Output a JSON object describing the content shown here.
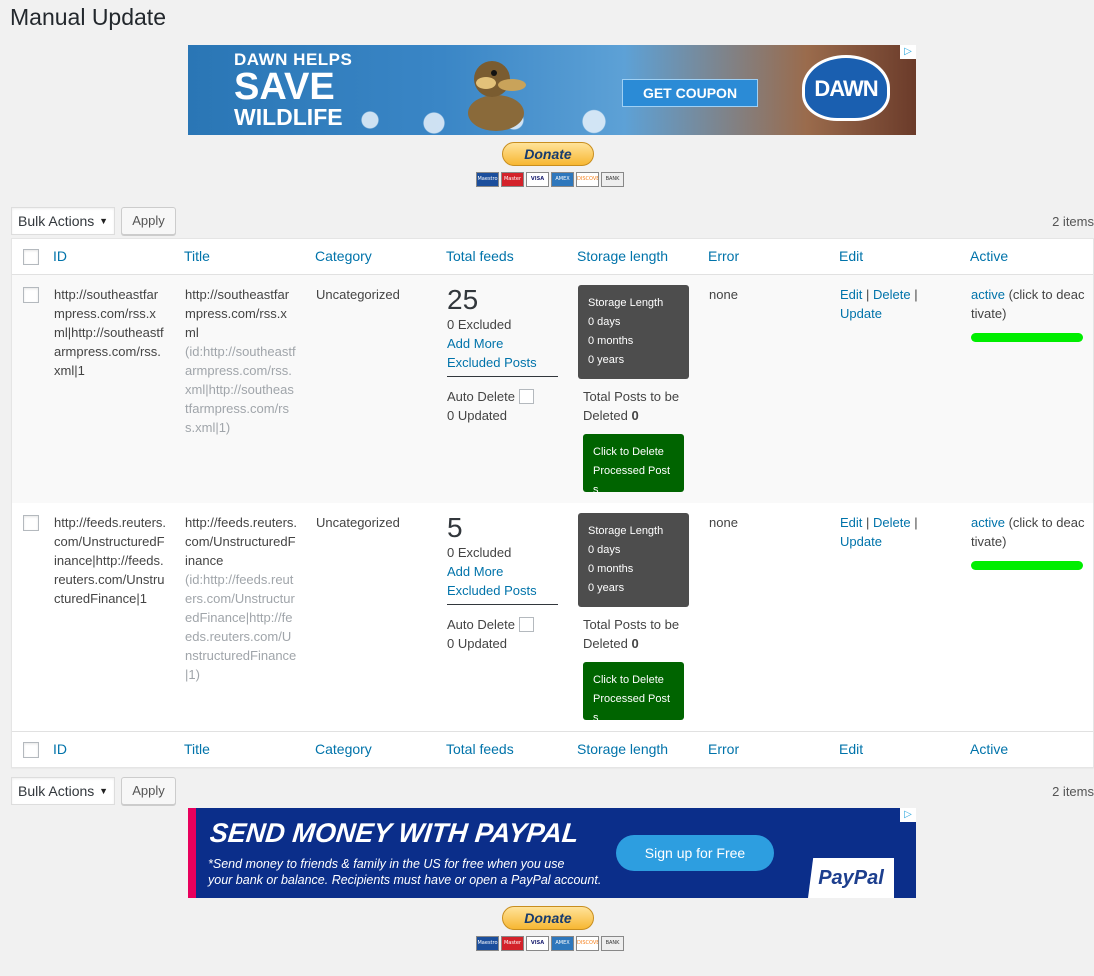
{
  "page": {
    "title": "Manual Update"
  },
  "ad_top": {
    "line1": "DAWN HELPS",
    "line2": "SAVE",
    "line3": "WILDLIFE",
    "button": "GET COUPON",
    "logo": "DAWN",
    "adchoices": "▷"
  },
  "ad_bottom": {
    "title": "SEND MONEY WITH PAYPAL",
    "sub1": "*Send money to friends & family in the US for free when you use",
    "sub2": "your bank or balance.  Recipients must have or open a PayPal account.",
    "button": "Sign up for Free",
    "logo": "PayPal",
    "adchoices": "▷"
  },
  "donate": {
    "label": "Donate",
    "cards": [
      "Maestro",
      "Master",
      "VISA",
      "AMEX",
      "DISCOVER",
      "BANK"
    ]
  },
  "tablenav": {
    "bulk_actions": "Bulk Actions",
    "apply": "Apply",
    "items": "2 items"
  },
  "columns": {
    "id": "ID",
    "title": "Title",
    "category": "Category",
    "total_feeds": "Total feeds",
    "storage_length": "Storage length",
    "error": "Error",
    "edit": "Edit",
    "active": "Active"
  },
  "rows": [
    {
      "id": "http://southeastfarmpress.com/rss.xml|http://southeastfarmpress.com/rss.xml|1",
      "title": "http://southeastfarmpress.com/rss.xml",
      "title_meta": "(id:http://southeastfarmpress.com/rss.xml|http://southeastfarmpress.com/rss.xml|1)",
      "category": "Uncategorized",
      "total": "25",
      "excluded": "0 Excluded",
      "add_more": "Add More",
      "excluded_posts": "Excluded Posts",
      "auto_delete": "Auto Delete",
      "updated": "0 Updated",
      "storage_title": "Storage Length",
      "days": "0 days",
      "months": "0 months",
      "years": "0 years",
      "to_delete_label": "Total Posts to be",
      "to_delete_label2": "Deleted",
      "to_delete_count": "0",
      "delete_btn1": "Click to Delete",
      "delete_btn2": "Processed Posts",
      "error": "none",
      "edit": "Edit",
      "delete": "Delete",
      "update": "Update",
      "sep": "|",
      "active": "active",
      "active_note": "(click to deactivate)"
    },
    {
      "id": "http://feeds.reuters.com/UnstructuredFinance|http://feeds.reuters.com/UnstructuredFinance|1",
      "title": "http://feeds.reuters.com/UnstructuredFinance",
      "title_meta": "(id:http://feeds.reuters.com/UnstructuredFinance|http://feeds.reuters.com/UnstructuredFinance|1)",
      "category": "Uncategorized",
      "total": "5",
      "excluded": "0 Excluded",
      "add_more": "Add More",
      "excluded_posts": "Excluded Posts",
      "auto_delete": "Auto Delete",
      "updated": "0 Updated",
      "storage_title": "Storage Length",
      "days": "0 days",
      "months": "0 months",
      "years": "0 years",
      "to_delete_label": "Total Posts to be",
      "to_delete_label2": "Deleted",
      "to_delete_count": "0",
      "delete_btn1": "Click to Delete",
      "delete_btn2": "Processed Posts",
      "error": "none",
      "edit": "Edit",
      "delete": "Delete",
      "update": "Update",
      "sep": "|",
      "active": "active",
      "active_note": "(click to deactivate)"
    }
  ],
  "colors": {
    "link": "#0073aa",
    "storage_box": "#4d4d4d",
    "delete_button": "#006400",
    "active_bar": "#00ee00"
  }
}
